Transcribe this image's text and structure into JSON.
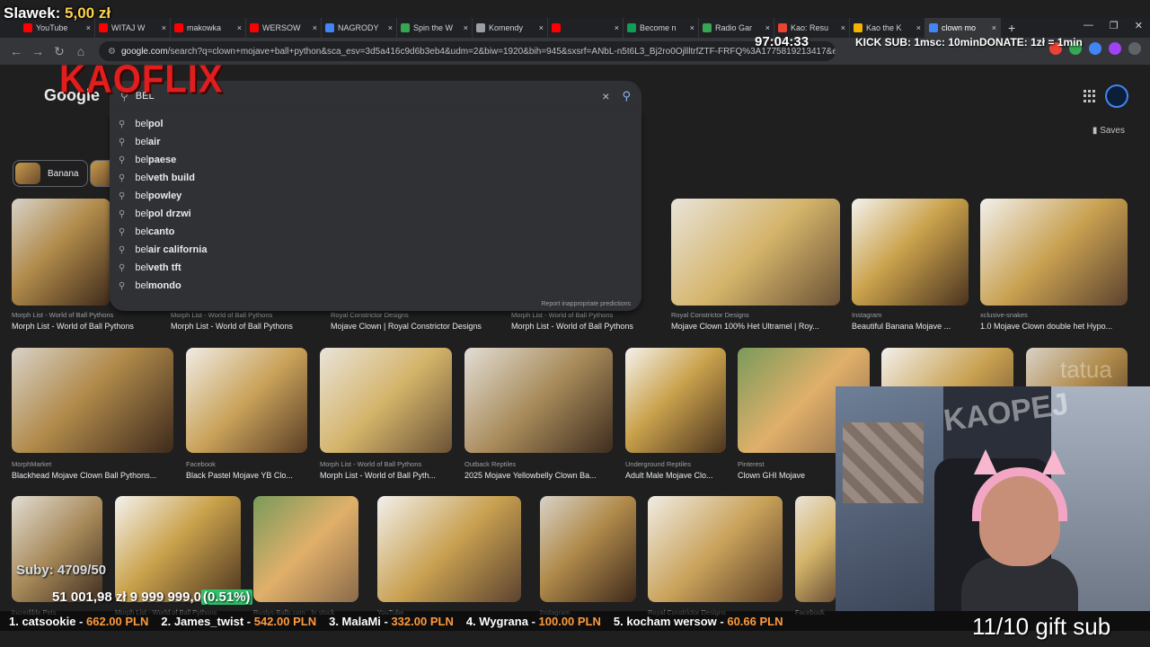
{
  "browser": {
    "tabs": [
      {
        "title": "YouTube",
        "color": "#ff0000",
        "active": false
      },
      {
        "title": "WITAJ W",
        "color": "#ff0000",
        "active": false
      },
      {
        "title": "makowka",
        "color": "#ff0000",
        "active": false
      },
      {
        "title": "WERSOW",
        "color": "#ff0000",
        "active": false
      },
      {
        "title": "NAGRODY",
        "color": "#4285f4",
        "active": false
      },
      {
        "title": "Spin the W",
        "color": "#34a853",
        "active": false
      },
      {
        "title": "Komendy",
        "color": "#9aa0a6",
        "active": false
      },
      {
        "title": "",
        "color": "#ff0000",
        "active": false
      },
      {
        "title": "Become n",
        "color": "#0f9d58",
        "active": false
      },
      {
        "title": "Radio Gar",
        "color": "#34a853",
        "active": false
      },
      {
        "title": "Kao: Resu",
        "color": "#ea4335",
        "active": false
      },
      {
        "title": "Kao the K",
        "color": "#f4b400",
        "active": false
      },
      {
        "title": "clown mo",
        "color": "#4285f4",
        "active": true
      }
    ],
    "tab_close": "×",
    "new_tab": "+",
    "win_controls": [
      "—",
      "❐",
      "✕"
    ],
    "nav": {
      "back": "←",
      "forward": "→",
      "reload": "↻",
      "home": "⌂"
    },
    "address_host": "google.com",
    "address_rest": "/search?q=clown+mojave+ball+python&sca_esv=3d5a416c9d6b3eb4&udm=2&biw=1920&bih=945&sxsrf=ANbL-n5t6L3_Bj2ro0OjllltrfZTF-FRFQ%3A1775819213417&ei=zdnYaYCPGf..."
  },
  "google": {
    "logo": "Google",
    "search_value": "BEL",
    "clear": "×",
    "search_icon": "search-icon",
    "suggestions": [
      {
        "prefix": "bel",
        "rest": " pol"
      },
      {
        "prefix": "bel",
        "rest": " air"
      },
      {
        "prefix": "bel",
        "rest": " paese"
      },
      {
        "prefix": "bel",
        "rest": " veth build"
      },
      {
        "prefix": "bel",
        "rest": " powley"
      },
      {
        "prefix": "bel",
        "rest": " pol drzwi"
      },
      {
        "prefix": "bel",
        "rest": " canto"
      },
      {
        "prefix": "bel",
        "rest": " air california"
      },
      {
        "prefix": "bel",
        "rest": " veth tft"
      },
      {
        "prefix": "bel",
        "rest": " mondo"
      }
    ],
    "report": "Report inappropriate predictions",
    "saves": "Saves",
    "chip": "Banana"
  },
  "results": {
    "row1": [
      {
        "src": "Morph List - World of Ball Pythons",
        "cap": "Morph List - World of Ball Pythons"
      },
      {
        "src": "Morph List - World of Ball Pythons",
        "cap": "Morph List - World of Ball Pythons"
      },
      {
        "src": "Royal Constrictor Designs",
        "cap": "Mojave Clown | Royal Constrictor Designs"
      },
      {
        "src": "Morph List - World of Ball Pythons",
        "cap": "Morph List - World of Ball Pythons"
      },
      {
        "src": "Royal Constrictor Designs",
        "cap": "Mojave Clown 100% Het Ultramel | Roy..."
      },
      {
        "src": "Instagram",
        "cap": "Beautiful Banana Mojave ..."
      },
      {
        "src": "xclusive-snakes",
        "cap": "1.0 Mojave Clown double het Hypo..."
      }
    ],
    "row2": [
      {
        "src": "MorphMarket",
        "cap": "Blackhead Mojave Clown Ball Pythons..."
      },
      {
        "src": "Facebook",
        "cap": "Black Pastel Mojave YB Clo..."
      },
      {
        "src": "Morph List - World of Ball Pythons",
        "cap": "Morph List - World of Ball Pyth..."
      },
      {
        "src": "Outback Reptiles",
        "cap": "2025 Mojave Yellowbelly Clown Ba..."
      },
      {
        "src": "Underground Reptiles",
        "cap": "Adult Male Mojave Clo..."
      },
      {
        "src": "Pinterest",
        "cap": "Clown GHI Mojave"
      }
    ],
    "row3_sources": [
      "Incredible Pets",
      "Morph List - World of Ball Pythons",
      "Rustys-Balls.com · In stock",
      "YouTube",
      "Instagram",
      "Royal Constrictor Designs",
      "Facebook"
    ]
  },
  "overlay": {
    "balance_label": "Slawek:",
    "balance_value": "5,00 zł",
    "timer": "97:04:33",
    "kick": "KICK SUB: 1msc: 10min",
    "donate": "DONATE: 1zł = 1min",
    "brand": "KAOFLIX",
    "subs": "Suby: 4709/50",
    "money_current": "51 001,98 zł",
    "money_goal": "9 999 999,0",
    "money_pct": "(0.51%)",
    "ranking": [
      {
        "name": "1. catsookie",
        "amount": "662.00 PLN"
      },
      {
        "name": "2. James_twist",
        "amount": "542.00 PLN"
      },
      {
        "name": "3. MalaMi",
        "amount": "332.00 PLN"
      },
      {
        "name": "4. Wygrana",
        "amount": "100.00 PLN"
      },
      {
        "name": "5. kocham wersow",
        "amount": "60.66 PLN"
      }
    ],
    "gift": "11/10 gift sub",
    "corner": "tatua",
    "graffiti": "KAOPEJ"
  }
}
